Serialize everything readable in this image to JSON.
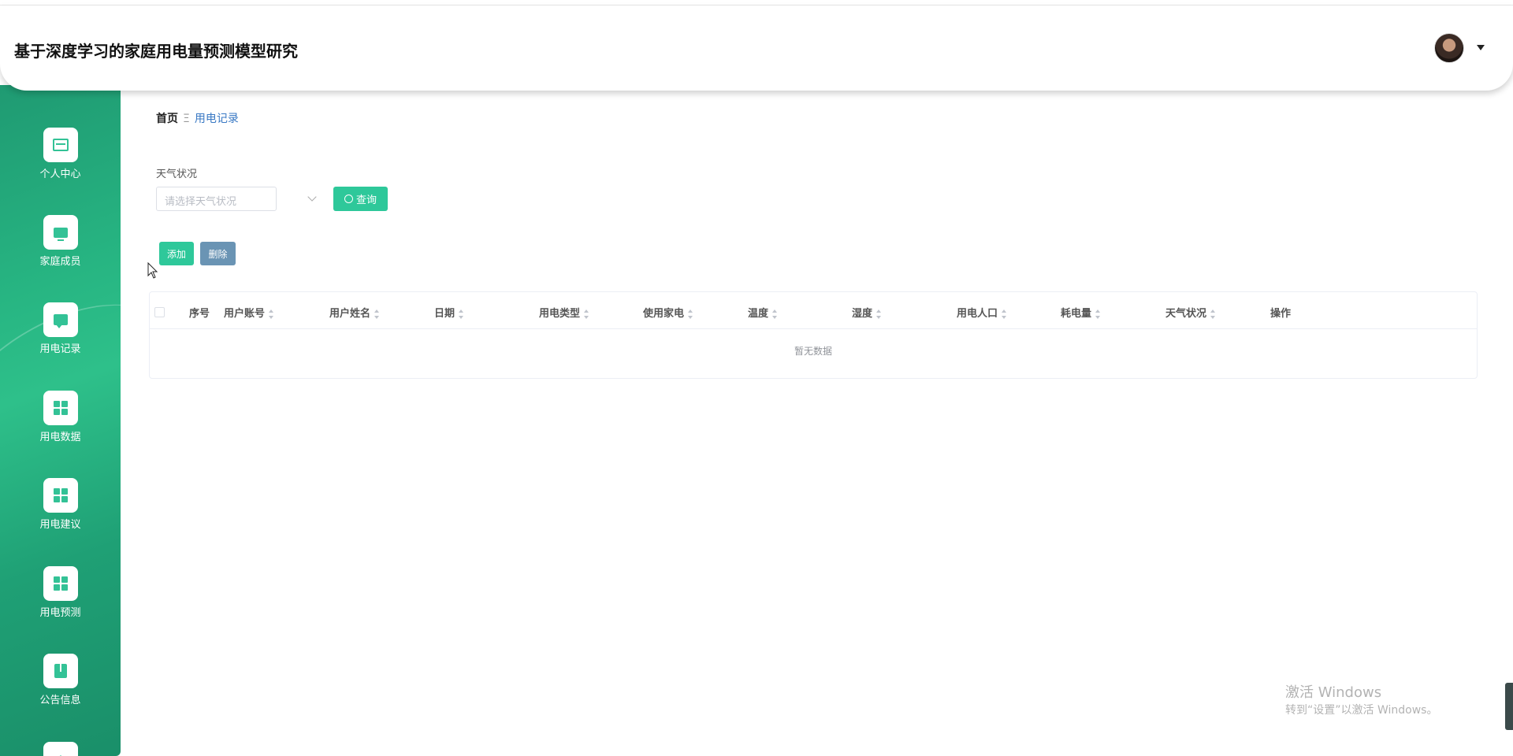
{
  "header": {
    "title": "基于深度学习的家庭用电量预测模型研究"
  },
  "sidebar": {
    "items": [
      {
        "label": "个人中心",
        "icon": "card-icon"
      },
      {
        "label": "家庭成员",
        "icon": "monitor-icon"
      },
      {
        "label": "用电记录",
        "icon": "chat-icon"
      },
      {
        "label": "用电数据",
        "icon": "grid-icon"
      },
      {
        "label": "用电建议",
        "icon": "grid-icon"
      },
      {
        "label": "用电预测",
        "icon": "grid-icon"
      },
      {
        "label": "公告信息",
        "icon": "book-icon"
      }
    ]
  },
  "breadcrumb": {
    "home": "首页",
    "separator": "Ξ",
    "current": "用电记录"
  },
  "filter": {
    "label": "天气状况",
    "placeholder": "请选择天气状况",
    "query_label": "查询"
  },
  "actions": {
    "add_label": "添加",
    "delete_label": "删除"
  },
  "table": {
    "columns": [
      "序号",
      "用户账号",
      "用户姓名",
      "日期",
      "用电类型",
      "使用家电",
      "温度",
      "湿度",
      "用电人口",
      "耗电量",
      "天气状况",
      "操作"
    ],
    "empty_text": "暂无数据"
  },
  "watermark": {
    "line1": "激活 Windows",
    "line2": "转到“设置”以激活 Windows。"
  },
  "colors": {
    "accent": "#2ec89a",
    "sidebar": "#22a97b",
    "danger_btn": "#6a94b4",
    "link": "#3a79c4"
  }
}
